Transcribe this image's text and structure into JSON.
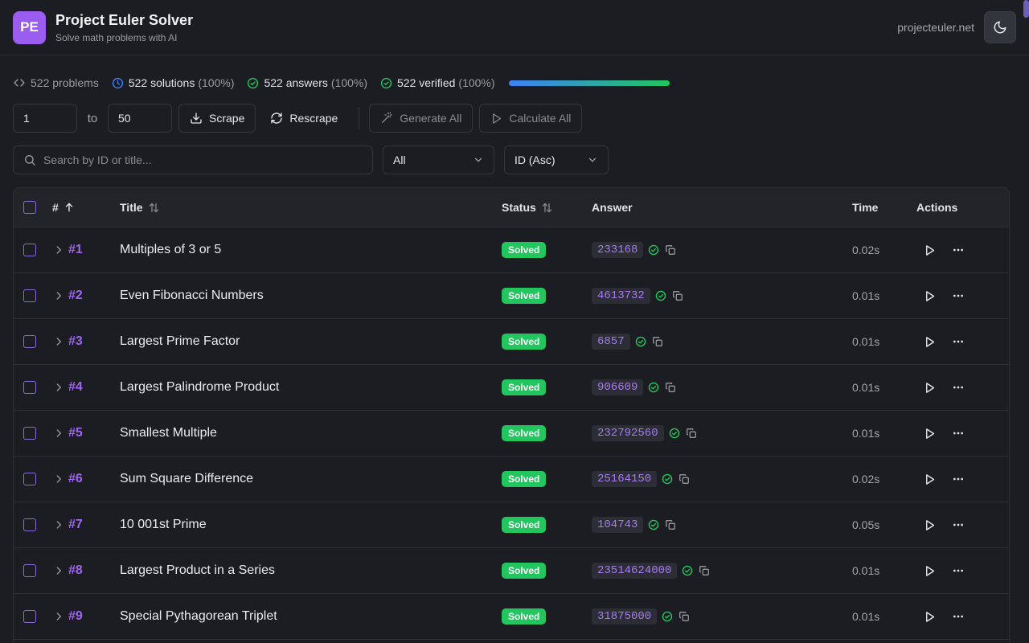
{
  "header": {
    "logo_text": "PE",
    "title": "Project Euler Solver",
    "subtitle": "Solve math problems with AI",
    "site_link": "projecteuler.net"
  },
  "stats": {
    "problems": "522 problems",
    "solutions": "522 solutions",
    "solutions_pct": "(100%)",
    "answers": "522 answers",
    "answers_pct": "(100%)",
    "verified": "522 verified",
    "verified_pct": "(100%)",
    "progress": 1.0
  },
  "controls": {
    "range_from": "1",
    "to_label": "to",
    "range_to": "50",
    "scrape": "Scrape",
    "rescrape": "Rescrape",
    "generate_all": "Generate All",
    "calculate_all": "Calculate All"
  },
  "filters": {
    "search_placeholder": "Search by ID or title...",
    "status_filter": "All",
    "sort": "ID (Asc)"
  },
  "table": {
    "columns": {
      "id": "#",
      "title": "Title",
      "status": "Status",
      "answer": "Answer",
      "time": "Time",
      "actions": "Actions"
    },
    "rows": [
      {
        "id": "#1",
        "title": "Multiples of 3 or 5",
        "status": "Solved",
        "answer": "233168",
        "time": "0.02s"
      },
      {
        "id": "#2",
        "title": "Even Fibonacci Numbers",
        "status": "Solved",
        "answer": "4613732",
        "time": "0.01s"
      },
      {
        "id": "#3",
        "title": "Largest Prime Factor",
        "status": "Solved",
        "answer": "6857",
        "time": "0.01s"
      },
      {
        "id": "#4",
        "title": "Largest Palindrome Product",
        "status": "Solved",
        "answer": "906609",
        "time": "0.01s"
      },
      {
        "id": "#5",
        "title": "Smallest Multiple",
        "status": "Solved",
        "answer": "232792560",
        "time": "0.01s"
      },
      {
        "id": "#6",
        "title": "Sum Square Difference",
        "status": "Solved",
        "answer": "25164150",
        "time": "0.02s"
      },
      {
        "id": "#7",
        "title": "10 001st Prime",
        "status": "Solved",
        "answer": "104743",
        "time": "0.05s"
      },
      {
        "id": "#8",
        "title": "Largest Product in a Series",
        "status": "Solved",
        "answer": "23514624000",
        "time": "0.01s"
      },
      {
        "id": "#9",
        "title": "Special Pythagorean Triplet",
        "status": "Solved",
        "answer": "31875000",
        "time": "0.01s"
      }
    ]
  },
  "colors": {
    "accent": "#9b5cf0",
    "success": "#22c55e",
    "info": "#3b82f6"
  }
}
